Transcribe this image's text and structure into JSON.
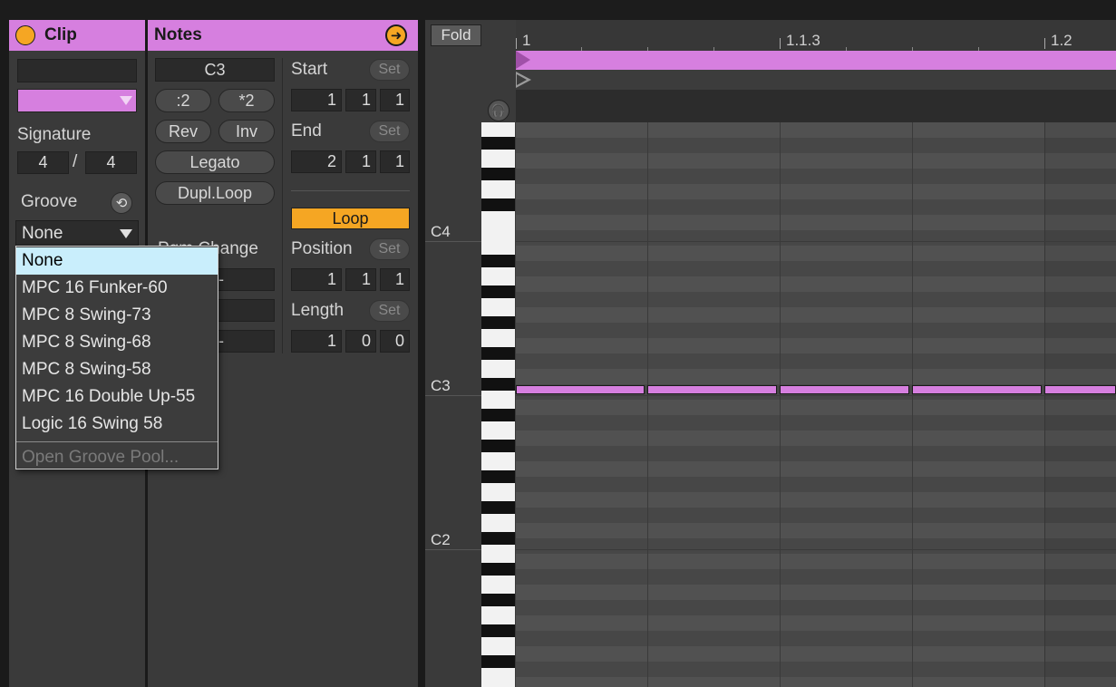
{
  "clip_panel": {
    "title": "Clip",
    "name_value": "",
    "color_hex": "#d67fdf",
    "signature_label": "Signature",
    "sig_numerator": "4",
    "sig_slash": "/",
    "sig_denominator": "4",
    "groove_label": "Groove",
    "groove_selected": "None"
  },
  "groove_menu": {
    "items": [
      "None",
      "MPC 16 Funker-60",
      "MPC 8 Swing-73",
      "MPC 8 Swing-68",
      "MPC 8 Swing-58",
      "MPC 16 Double Up-55",
      "Logic 16 Swing 58"
    ],
    "open_pool": "Open Groove Pool..."
  },
  "notes_panel": {
    "title": "Notes",
    "key": "C3",
    "half_label": ":2",
    "double_label": "*2",
    "rev_label": "Rev",
    "inv_label": "Inv",
    "legato_label": "Legato",
    "dupl_label": "Dupl.Loop",
    "pgm_partial": "Pgm Change",
    "start_label": "Start",
    "start_values": [
      "1",
      "1",
      "1"
    ],
    "end_label": "End",
    "end_values": [
      "2",
      "1",
      "1"
    ],
    "set_label": "Set",
    "loop_label": "Loop",
    "position_label": "Position",
    "position_values": [
      "1",
      "1",
      "1"
    ],
    "length_label": "Length",
    "length_values": [
      "1",
      "0",
      "0"
    ],
    "dash": "-"
  },
  "editor": {
    "fold_label": "Fold",
    "ruler": [
      "1",
      "1.1.3",
      "1.2"
    ],
    "key_labels": [
      "C4",
      "C3",
      "C2"
    ],
    "note_color": "#d67fdf",
    "accent_color": "#f5a623"
  }
}
